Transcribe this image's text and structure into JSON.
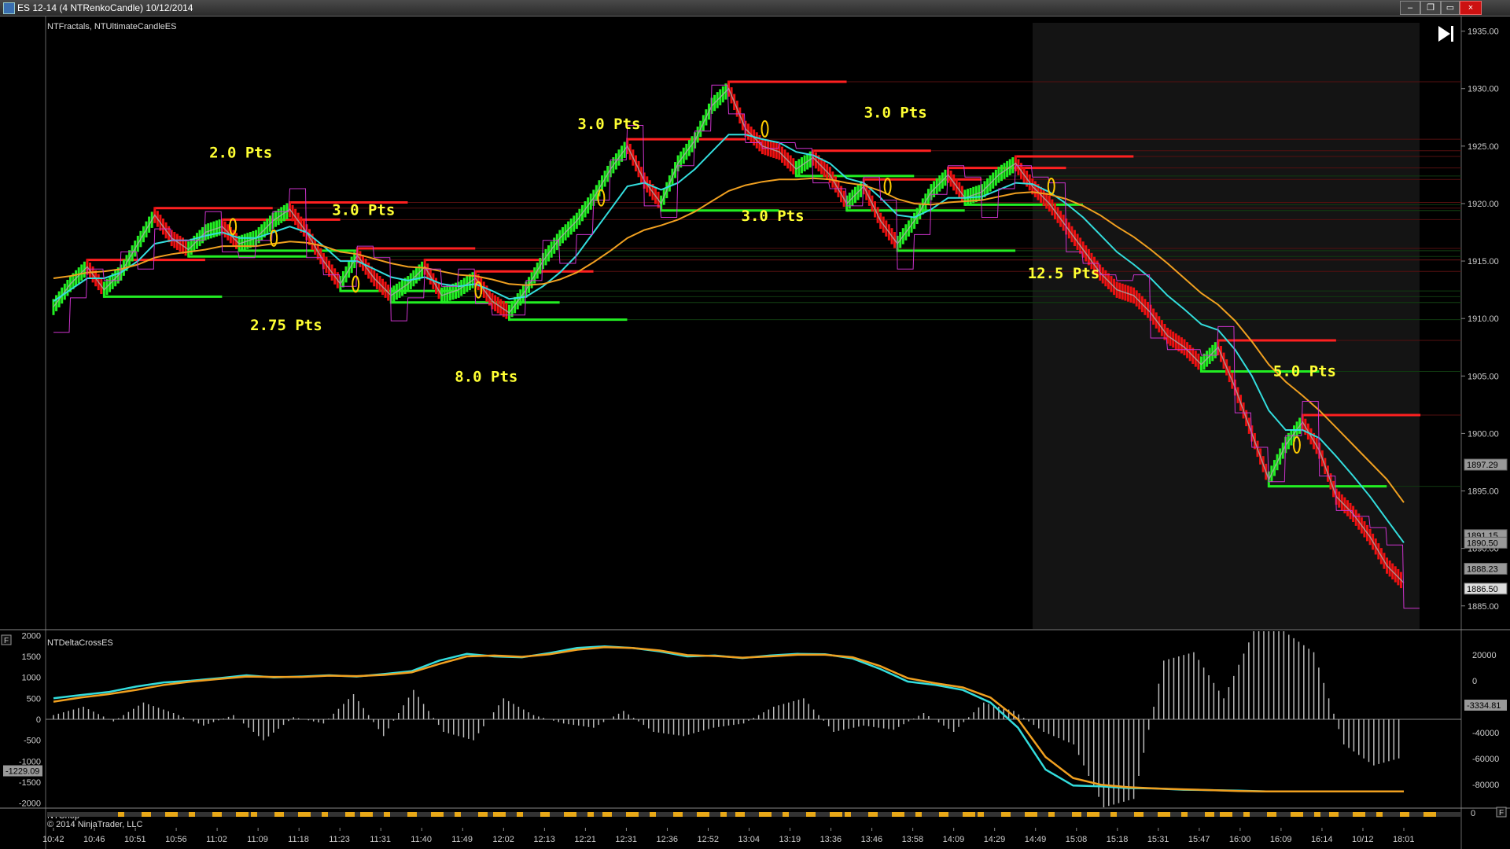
{
  "window": {
    "title": "ES 12-14 (4 NTRenkoCandle)  10/12/2014",
    "close_icon": "close-icon",
    "restore_icon": "restore-icon",
    "minimize_icon": "minimize-icon"
  },
  "colors": {
    "background": "#000000",
    "up_bar": "#22ee22",
    "down_bar": "#ee1111",
    "neutral_bar": "#eeee22",
    "cyan_line": "#33dddd",
    "orange_line": "#f0a020",
    "gray_line": "#aaaaaa",
    "magenta_line": "#cc33cc",
    "annotation": "#ffff33",
    "session_shade": "#141414"
  },
  "chart_data": [
    {
      "type": "line",
      "panel": "price",
      "title": "NTFractals, NTUltimateCandleES",
      "y_axis_position": "right",
      "ylim": [
        1883.0,
        1936.0
      ],
      "y_ticks": [
        1885.0,
        1890.0,
        1895.0,
        1900.0,
        1905.0,
        1910.0,
        1915.0,
        1920.0,
        1925.0,
        1930.0,
        1935.0
      ],
      "y_tick_labels": [
        "1885.00",
        "1890.00",
        "1895.00",
        "1900.00",
        "1905.00",
        "1910.00",
        "1915.00",
        "1920.00",
        "1925.00",
        "1930.00",
        "1935.00"
      ],
      "x_tick_labels": [
        "10:42",
        "10:46",
        "10:51",
        "10:56",
        "11:02",
        "11:09",
        "11:18",
        "11:23",
        "11:31",
        "11:40",
        "11:49",
        "12:02",
        "12:13",
        "12:21",
        "12:31",
        "12:36",
        "12:52",
        "13:04",
        "13:19",
        "13:36",
        "13:46",
        "13:58",
        "14:09",
        "14:29",
        "14:49",
        "15:08",
        "15:18",
        "15:31",
        "15:47",
        "16:00",
        "16:09",
        "16:14",
        "10/12",
        "18:01"
      ],
      "shaded_session_start": "14:49",
      "series": [
        {
          "role": "price",
          "color": "#e8e8e8",
          "values": [
            1911.0,
            1913.0,
            1914.5,
            1912.5,
            1914.0,
            1916.5,
            1919.0,
            1917.0,
            1916.0,
            1917.5,
            1918.0,
            1916.5,
            1917.0,
            1918.5,
            1919.5,
            1917.5,
            1915.0,
            1913.0,
            1915.5,
            1913.5,
            1912.0,
            1913.0,
            1914.5,
            1912.0,
            1912.5,
            1913.5,
            1911.5,
            1910.5,
            1912.5,
            1915.0,
            1917.0,
            1918.5,
            1920.5,
            1923.0,
            1925.0,
            1922.0,
            1920.0,
            1923.5,
            1925.5,
            1928.5,
            1930.0,
            1926.5,
            1925.0,
            1924.5,
            1923.0,
            1924.0,
            1922.5,
            1920.0,
            1921.5,
            1918.5,
            1916.5,
            1918.5,
            1921.0,
            1922.5,
            1920.5,
            1921.0,
            1922.5,
            1923.5,
            1921.5,
            1920.0,
            1918.0,
            1916.0,
            1914.0,
            1912.5,
            1912.0,
            1910.5,
            1908.5,
            1907.5,
            1906.0,
            1907.5,
            1904.0,
            1900.0,
            1896.0,
            1899.0,
            1901.0,
            1898.5,
            1894.5,
            1893.0,
            1891.0,
            1888.5,
            1887.0
          ]
        },
        {
          "role": "fast average",
          "color": "#33dddd",
          "values": [
            1911.5,
            1912.5,
            1913.5,
            1913.5,
            1914.0,
            1915.0,
            1916.5,
            1916.8,
            1916.8,
            1917.2,
            1917.5,
            1917.0,
            1917.0,
            1917.5,
            1918.0,
            1917.5,
            1916.3,
            1915.0,
            1915.0,
            1914.3,
            1913.6,
            1913.3,
            1913.6,
            1913.0,
            1912.8,
            1913.0,
            1912.4,
            1911.7,
            1911.9,
            1912.8,
            1914.0,
            1915.5,
            1917.5,
            1919.5,
            1921.5,
            1921.8,
            1921.2,
            1921.8,
            1923.0,
            1924.5,
            1926.0,
            1926.0,
            1925.6,
            1925.3,
            1924.5,
            1924.2,
            1923.5,
            1922.2,
            1921.8,
            1920.5,
            1919.0,
            1918.8,
            1919.5,
            1920.5,
            1920.5,
            1920.6,
            1921.2,
            1921.8,
            1921.7,
            1921.0,
            1920.0,
            1918.8,
            1917.3,
            1915.8,
            1914.7,
            1913.5,
            1912.0,
            1910.8,
            1909.5,
            1909.0,
            1907.3,
            1905.0,
            1902.0,
            1900.3,
            1900.3,
            1899.6,
            1898.0,
            1896.3,
            1894.5,
            1892.5,
            1890.5
          ]
        },
        {
          "role": "slow average",
          "color": "#f0a020",
          "values": [
            1913.5,
            1913.7,
            1914.0,
            1914.1,
            1914.3,
            1914.7,
            1915.3,
            1915.6,
            1915.8,
            1916.0,
            1916.3,
            1916.3,
            1916.3,
            1916.5,
            1916.7,
            1916.6,
            1916.3,
            1915.8,
            1915.6,
            1915.2,
            1914.8,
            1914.5,
            1914.4,
            1914.1,
            1913.8,
            1913.7,
            1913.4,
            1913.0,
            1912.9,
            1913.0,
            1913.4,
            1914.0,
            1914.9,
            1915.9,
            1917.0,
            1917.7,
            1918.1,
            1918.6,
            1919.3,
            1920.2,
            1921.1,
            1921.6,
            1921.9,
            1922.1,
            1922.1,
            1922.2,
            1922.1,
            1921.8,
            1921.6,
            1921.1,
            1920.4,
            1920.0,
            1919.9,
            1920.1,
            1920.2,
            1920.3,
            1920.6,
            1920.9,
            1921.0,
            1920.8,
            1920.4,
            1919.8,
            1919.0,
            1918.0,
            1917.1,
            1916.0,
            1914.8,
            1913.5,
            1912.2,
            1911.2,
            1909.8,
            1908.0,
            1906.0,
            1904.5,
            1903.3,
            1902.0,
            1900.5,
            1899.0,
            1897.5,
            1896.0,
            1894.0
          ]
        }
      ],
      "annotations": [
        {
          "text": "2.0 Pts",
          "at": "11:02"
        },
        {
          "text": "2.75 Pts",
          "at": "11:09"
        },
        {
          "text": "3.0 Pts",
          "at": "11:23"
        },
        {
          "text": "8.0 Pts",
          "at": "11:49"
        },
        {
          "text": "3.0 Pts",
          "at": "12:21"
        },
        {
          "text": "3.0 Pts",
          "at": "13:04"
        },
        {
          "text": "3.0 Pts",
          "at": "13:46"
        },
        {
          "text": "12.5 Pts",
          "at": "14:49"
        },
        {
          "text": "5.0 Pts",
          "at": "16:09"
        }
      ],
      "price_markers": [
        {
          "label": "1897.29",
          "value": 1897.29,
          "style": "gray"
        },
        {
          "label": "1891.15",
          "value": 1891.15,
          "style": "gray"
        },
        {
          "label": "1890.50",
          "value": 1890.5,
          "style": "gray"
        },
        {
          "label": "1888.23",
          "value": 1888.23,
          "style": "gray"
        },
        {
          "label": "1886.50",
          "value": 1886.5,
          "style": "white"
        }
      ]
    },
    {
      "type": "line",
      "panel": "oscillator",
      "title": "NTDeltaCrossES",
      "left_axis": {
        "ylim": [
          -2100,
          2100
        ],
        "ticks": [
          2000,
          1500,
          1000,
          500,
          0,
          -500,
          -1000,
          -1500,
          -2000
        ],
        "tick_labels": [
          "2000",
          "1500",
          "1000",
          "500",
          "0",
          "-500",
          "-1000",
          "-1500",
          "-2000"
        ]
      },
      "right_axis": {
        "tick_labels": [
          "20000",
          "0",
          "-20000",
          "-40000",
          "-60000",
          "-80000"
        ]
      },
      "markers": [
        {
          "label": "-1229.09",
          "axis": "left"
        },
        {
          "label": "-3334.81",
          "axis": "right"
        }
      ],
      "series": [
        {
          "role": "cyan line",
          "color": "#33dddd",
          "values": [
            500,
            580,
            650,
            780,
            880,
            920,
            980,
            1050,
            1000,
            1020,
            1050,
            1020,
            1080,
            1150,
            1400,
            1560,
            1500,
            1480,
            1580,
            1700,
            1740,
            1700,
            1620,
            1500,
            1520,
            1460,
            1520,
            1560,
            1550,
            1450,
            1200,
            900,
            820,
            700,
            400,
            -200,
            -1200,
            -1580,
            -1600,
            -1640,
            -1650,
            -1680,
            -1690,
            -1700,
            -1720,
            -1720,
            -1720,
            -1720,
            -1720,
            -1720
          ]
        },
        {
          "role": "orange line",
          "color": "#f0a020",
          "values": [
            420,
            520,
            600,
            700,
            820,
            900,
            960,
            1020,
            1010,
            1010,
            1040,
            1030,
            1060,
            1120,
            1320,
            1500,
            1520,
            1490,
            1550,
            1660,
            1720,
            1700,
            1640,
            1530,
            1510,
            1470,
            1500,
            1540,
            1540,
            1480,
            1270,
            980,
            860,
            760,
            520,
            0,
            -900,
            -1400,
            -1560,
            -1620,
            -1650,
            -1670,
            -1690,
            -1710,
            -1720,
            -1720,
            -1720,
            -1720,
            -1720,
            -1720
          ]
        },
        {
          "role": "histogram",
          "color": "#bbbbbb",
          "values": [
            100,
            300,
            -50,
            400,
            150,
            -150,
            100,
            -500,
            50,
            -100,
            600,
            -400,
            700,
            -300,
            -500,
            500,
            100,
            -100,
            -200,
            200,
            -300,
            -400,
            -200,
            -100,
            300,
            500,
            -300,
            -150,
            -250,
            150,
            -300,
            400,
            200,
            -300,
            -600,
            -2100,
            -1900,
            1400,
            1600,
            500,
            2100,
            2100,
            1600,
            -600,
            -1100,
            -900
          ]
        }
      ]
    },
    {
      "type": "bar",
      "panel": "chop",
      "title": "NTChop",
      "color": "#e8a818"
    }
  ],
  "footer": {
    "copyright": "© 2014 NinjaTrader, LLC"
  },
  "navigate_icon": "skip-to-end-icon",
  "panel_menu_label": "F"
}
